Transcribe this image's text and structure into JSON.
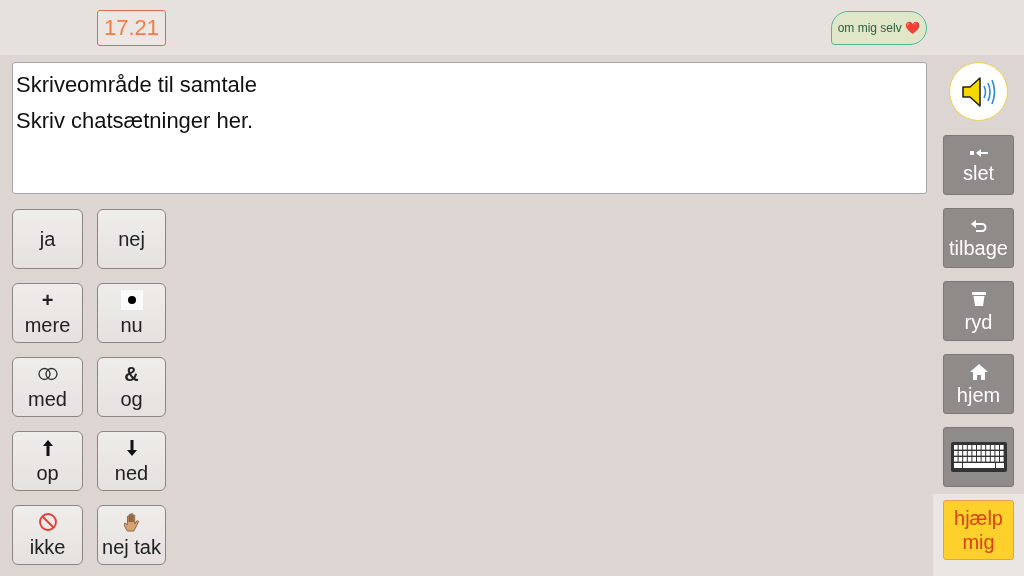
{
  "clock": "17.21",
  "profile_bubble": {
    "label": "om mig selv",
    "emoji": "❤️"
  },
  "message_area": {
    "lines": [
      "Skriveområde til samtale",
      "Skriv chatsætninger her."
    ]
  },
  "word_button_rows": [
    [
      {
        "label": "ja"
      },
      {
        "label": "nej"
      }
    ],
    [
      {
        "label": "mere",
        "symbol": "+"
      },
      {
        "label": "nu"
      }
    ],
    [
      {
        "label": "med"
      },
      {
        "label": "og",
        "symbol": "&"
      }
    ],
    [
      {
        "label": "op"
      },
      {
        "label": "ned"
      }
    ],
    [
      {
        "label": "ikke"
      },
      {
        "label": "nej tak"
      }
    ]
  ],
  "side_buttons": [
    {
      "kind": "action",
      "label": "slet"
    },
    {
      "kind": "action",
      "label": "tilbage"
    },
    {
      "kind": "action",
      "label": "ryd"
    },
    {
      "kind": "action",
      "label": "hjem"
    },
    {
      "kind": "action"
    },
    {
      "kind": "help",
      "label": "hjælp mig"
    }
  ]
}
